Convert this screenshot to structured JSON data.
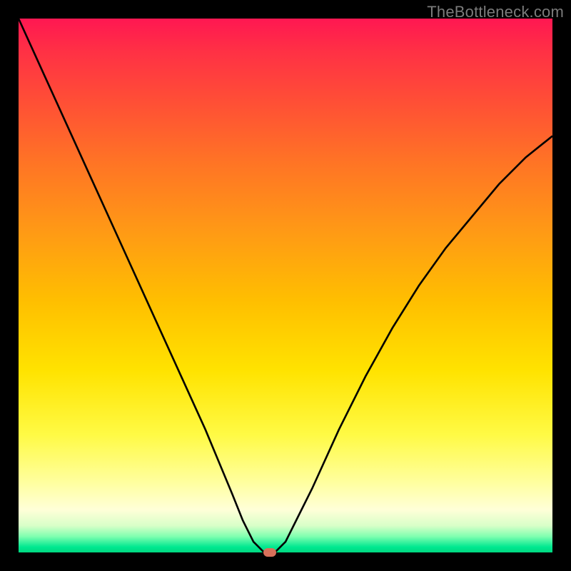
{
  "watermark": "TheBottleneck.com",
  "colors": {
    "frame": "#000000",
    "curve": "#000000",
    "marker": "#d8705a",
    "gradient_top": "#ff1752",
    "gradient_bottom": "#00d880"
  },
  "chart_data": {
    "type": "line",
    "title": "",
    "xlabel": "",
    "ylabel": "",
    "xlim": [
      0,
      100
    ],
    "ylim": [
      0,
      100
    ],
    "grid": false,
    "series": [
      {
        "name": "bottleneck-curve",
        "x": [
          0,
          5,
          10,
          15,
          20,
          25,
          30,
          35,
          40,
          42,
          44,
          46,
          47,
          48,
          50,
          52,
          55,
          60,
          65,
          70,
          75,
          80,
          85,
          90,
          95,
          100
        ],
        "y": [
          100,
          89,
          78,
          67,
          56,
          45,
          34,
          23,
          11,
          6,
          2,
          0,
          0,
          0,
          2,
          6,
          12,
          23,
          33,
          42,
          50,
          57,
          63,
          69,
          74,
          78
        ]
      }
    ],
    "marker": {
      "x": 47,
      "y": 0
    },
    "annotations": []
  }
}
